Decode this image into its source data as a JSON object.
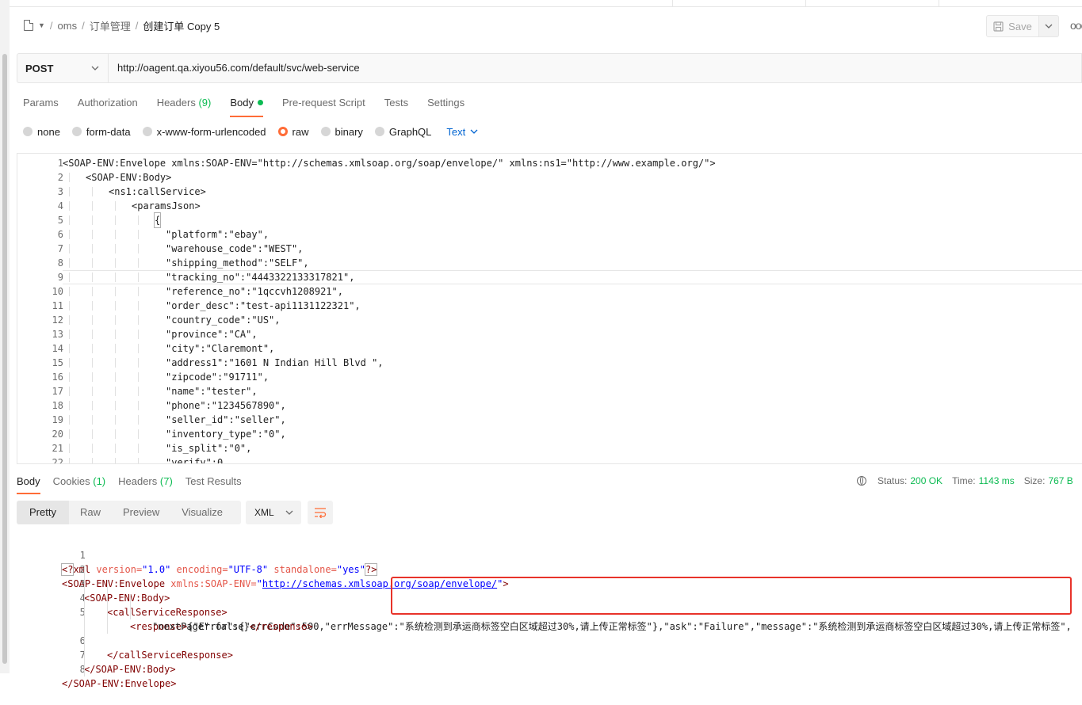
{
  "breadcrumb": {
    "items": [
      "oms",
      "订单管理"
    ],
    "current": "创建订单 Copy 5",
    "sep": "/"
  },
  "toolbar": {
    "save_label": "Save",
    "more": "ooo"
  },
  "request": {
    "method": "POST",
    "url": "http://oagent.qa.xiyou56.com/default/svc/web-service"
  },
  "tabs": [
    {
      "label": "Params"
    },
    {
      "label": "Authorization"
    },
    {
      "label": "Headers",
      "count": "(9)"
    },
    {
      "label": "Body"
    },
    {
      "label": "Pre-request Script"
    },
    {
      "label": "Tests"
    },
    {
      "label": "Settings"
    }
  ],
  "body_modes": [
    "none",
    "form-data",
    "x-www-form-urlencoded",
    "raw",
    "binary",
    "GraphQL"
  ],
  "body_selected": "raw",
  "body_format": "Text",
  "request_lines": [
    "<SOAP-ENV:Envelope xmlns:SOAP-ENV=\"http://schemas.xmlsoap.org/soap/envelope/\" xmlns:ns1=\"http://www.example.org/\">",
    "<SOAP-ENV:Body>",
    "<ns1:callService>",
    "<paramsJson>",
    "{",
    "\"platform\":\"ebay\",",
    "\"warehouse_code\":\"WEST\",",
    "\"shipping_method\":\"SELF\",",
    "\"tracking_no\":\"4443322133317821\",",
    "\"reference_no\":\"1qccvh1208921\",",
    "\"order_desc\":\"test-api1131122321\",",
    "\"country_code\":\"US\",",
    "\"province\":\"CA\",",
    "\"city\":\"Claremont\",",
    "\"address1\":\"1601 N Indian Hill Blvd \",",
    "\"zipcode\":\"91711\",",
    "\"name\":\"tester\",",
    "\"phone\":\"1234567890\",",
    "\"seller_id\":\"seller\",",
    "\"inventory_type\":\"0\",",
    "\"is_split\":\"0\",",
    "\"verify\":0"
  ],
  "response_tabs": [
    {
      "label": "Body"
    },
    {
      "label": "Cookies",
      "count": "(1)"
    },
    {
      "label": "Headers",
      "count": "(7)"
    },
    {
      "label": "Test Results"
    }
  ],
  "status": {
    "status_label": "Status:",
    "status_value": "200 OK",
    "time_label": "Time:",
    "time_value": "1143 ms",
    "size_label": "Size:",
    "size_value": "767 B"
  },
  "views": [
    "Pretty",
    "Raw",
    "Preview",
    "Visualize"
  ],
  "response_format": "XML",
  "response": {
    "l1_open": "<?",
    "l1_xml": "xml",
    "l1_a1": "version=",
    "l1_v1": "\"1.0\"",
    "l1_a2": "encoding=",
    "l1_v2": "\"UTF-8\"",
    "l1_a3": "standalone=",
    "l1_v3": "\"yes\"",
    "l1_close": "?>",
    "l2_tag": "<SOAP-ENV:Envelope",
    "l2_attr": "xmlns:SOAP-ENV=",
    "l2_q1": "\"",
    "l2_link": "http://schemas.xmlsoap.org/soap/envelope/",
    "l2_q2": "\"",
    "l2_end": ">",
    "l3": "<SOAP-ENV:Body>",
    "l4": "<callServiceResponse>",
    "l5_tag": "<response>",
    "l5_text": "{\"Error\":{\"errCode\":500,\"errMessage\":\"系统检测到承运商标签空白区域超过30%,请上传正常标签\"},\"ask\":\"Failure\",\"message\":\"系统检测到承运商标签空白区域超过30%,请上传正常标签\",",
    "l5b_text": "\"nextPage\":false}",
    "l5b_tag": "</response>",
    "l6": "</callServiceResponse>",
    "l7": "</SOAP-ENV:Body>",
    "l8": "</SOAP-ENV:Envelope>"
  },
  "colors": {
    "accent": "#ff6c37",
    "success": "#0cbb52",
    "link": "#0265d2",
    "highlight": "#e8332a"
  }
}
